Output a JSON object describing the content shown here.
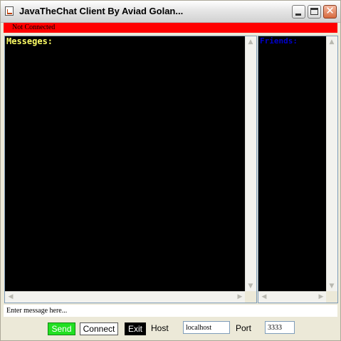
{
  "window": {
    "title": "JavaTheChat Client By Aviad Golan..."
  },
  "title_buttons": {
    "minimize_icon": "minimize-icon",
    "maximize_icon": "maximize-icon",
    "close_icon": "close-icon",
    "close_glyph": "✕"
  },
  "status": {
    "text": "Not Connected",
    "color": "#ff0000"
  },
  "messages": {
    "label": "Messeges:",
    "label_color": "#ffff66",
    "background": "#000000"
  },
  "users": {
    "label": "Friends:",
    "label_color": "#0000cc"
  },
  "input": {
    "placeholder": "Enter message here..."
  },
  "controls": {
    "send_label": "Send",
    "send_color": "#22e022",
    "connect_label": "Connect",
    "exit_label": "Exit",
    "host_label": "Host",
    "host_value": "localhost",
    "port_label": "Port",
    "port_value": "3333"
  }
}
